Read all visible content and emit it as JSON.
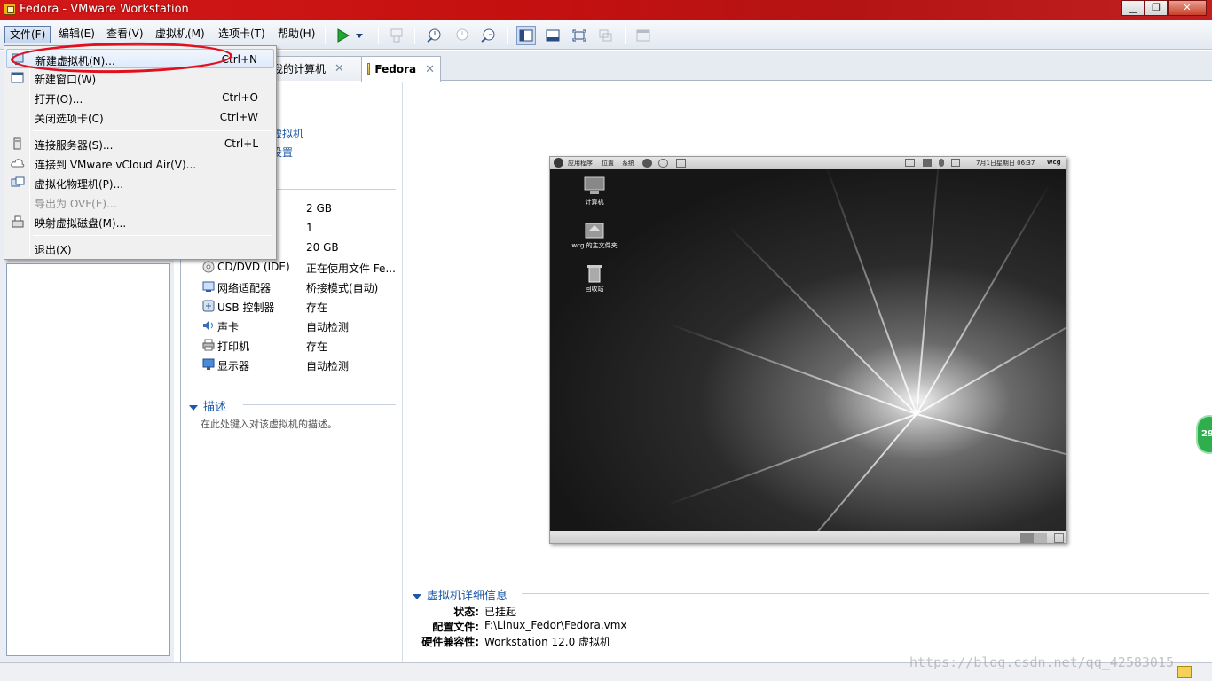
{
  "window": {
    "title": "Fedora - VMware Workstation",
    "controls": {
      "minimize": "▁",
      "maximize": "❐",
      "close": "✕"
    }
  },
  "menubar": {
    "items": [
      "文件(F)",
      "编辑(E)",
      "查看(V)",
      "虚拟机(M)",
      "选项卡(T)",
      "帮助(H)"
    ]
  },
  "toolbar": {
    "icons": [
      "play-icon",
      "dropdown-arrow-icon",
      "send-keys-icon",
      "snapshot-take-icon",
      "snapshot-revert-icon",
      "snapshot-manager-icon",
      "library-view-icon",
      "thumbnail-bar-icon",
      "fullscreen-icon",
      "unity-icon",
      "console-view-icon"
    ]
  },
  "tabs": [
    {
      "label": "我的计算机",
      "close": "✕"
    },
    {
      "label": "Fedora",
      "close": "✕",
      "active": true
    }
  ],
  "vm": {
    "name_fragment": "a",
    "actions": [
      "虚拟机",
      "设置"
    ]
  },
  "devices": [
    {
      "icon": "memory-icon",
      "name": "",
      "value": "2 GB"
    },
    {
      "icon": "cpu-icon",
      "name": "",
      "value": "1"
    },
    {
      "icon": "harddisk-icon",
      "name": "",
      "value": "20 GB"
    },
    {
      "icon": "cdrom-icon",
      "name": "CD/DVD (IDE)",
      "value": "正在使用文件 Fe..."
    },
    {
      "icon": "network-icon",
      "name": "网络适配器",
      "value": "桥接模式(自动)"
    },
    {
      "icon": "usb-icon",
      "name": "USB 控制器",
      "value": "存在"
    },
    {
      "icon": "sound-icon",
      "name": "声卡",
      "value": "自动检测"
    },
    {
      "icon": "printer-icon",
      "name": "打印机",
      "value": "存在"
    },
    {
      "icon": "display-icon",
      "name": "显示器",
      "value": "自动检测"
    }
  ],
  "description": {
    "heading": "描述",
    "placeholder": "在此处键入对该虚拟机的描述。"
  },
  "guest": {
    "panel_menus": [
      "应用程序",
      "位置",
      "系统"
    ],
    "clock": "7月1日星期日 06:37",
    "user": "wcg",
    "desktop_icons": [
      {
        "icon": "computer-icon",
        "label": "计算机"
      },
      {
        "icon": "home-folder-icon",
        "label": "wcg 的主文件夹"
      },
      {
        "icon": "trash-icon",
        "label": "回收站"
      }
    ]
  },
  "details": {
    "heading": "虚拟机详细信息",
    "rows": [
      {
        "label": "状态:",
        "value": "已挂起"
      },
      {
        "label": "配置文件:",
        "value": "F:\\Linux_Fedor\\Fedora.vmx"
      },
      {
        "label": "硬件兼容性:",
        "value": "Workstation 12.0 虚拟机"
      }
    ]
  },
  "file_menu": {
    "items": [
      {
        "icon": "new-vm-icon",
        "label": "新建虚拟机(N)...",
        "shortcut": "Ctrl+N",
        "highlighted": true
      },
      {
        "icon": "new-window-icon",
        "label": "新建窗口(W)",
        "shortcut": ""
      },
      {
        "icon": "",
        "label": "打开(O)...",
        "shortcut": "Ctrl+O"
      },
      {
        "icon": "",
        "label": "关闭选项卡(C)",
        "shortcut": "Ctrl+W"
      },
      {
        "icon": "server-icon",
        "label": "连接服务器(S)...",
        "shortcut": "Ctrl+L"
      },
      {
        "icon": "cloud-icon",
        "label": "连接到 VMware vCloud Air(V)...",
        "shortcut": ""
      },
      {
        "icon": "virtualize-pc-icon",
        "label": "虚拟化物理机(P)...",
        "shortcut": ""
      },
      {
        "icon": "",
        "label": "导出为 OVF(E)...",
        "shortcut": "",
        "disabled": true
      },
      {
        "icon": "map-disk-icon",
        "label": "映射虚拟磁盘(M)...",
        "shortcut": ""
      },
      {
        "icon": "",
        "label": "退出(X)",
        "shortcut": ""
      }
    ]
  },
  "overlay": {
    "badge": "29",
    "watermark": "https://blog.csdn.net/qq_42583015"
  },
  "colors": {
    "titlebar": "#c41010",
    "link": "#1c57a8",
    "annotation": "#e0101e",
    "play": "#1faa2e"
  }
}
